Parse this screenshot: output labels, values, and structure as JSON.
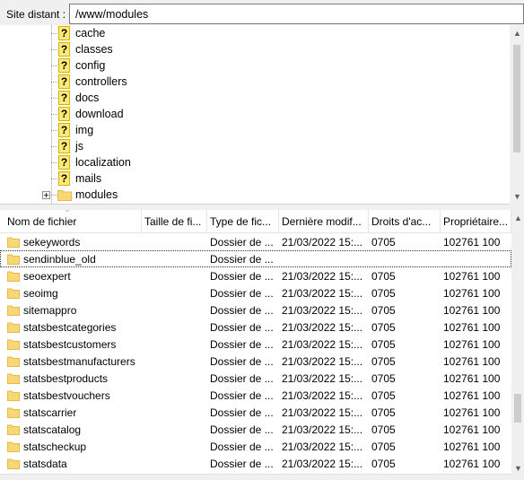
{
  "remote_site": {
    "label": "Site distant :",
    "path": "/www/modules"
  },
  "tree": {
    "items": [
      {
        "name": "cache",
        "icon": "question-folder-icon"
      },
      {
        "name": "classes",
        "icon": "question-folder-icon"
      },
      {
        "name": "config",
        "icon": "question-folder-icon"
      },
      {
        "name": "controllers",
        "icon": "question-folder-icon"
      },
      {
        "name": "docs",
        "icon": "question-folder-icon"
      },
      {
        "name": "download",
        "icon": "question-folder-icon"
      },
      {
        "name": "img",
        "icon": "question-folder-icon"
      },
      {
        "name": "js",
        "icon": "question-folder-icon"
      },
      {
        "name": "localization",
        "icon": "question-folder-icon"
      },
      {
        "name": "mails",
        "icon": "question-folder-icon"
      },
      {
        "name": "modules",
        "icon": "folder-icon",
        "expandable": true
      }
    ],
    "question_glyph": "?"
  },
  "file_list": {
    "columns": [
      "Nom de fichier",
      "Taille de fi...",
      "Type de fic...",
      "Dernière modif...",
      "Droits d'ac...",
      "Propriétaire..."
    ],
    "sort_indicator": "^",
    "rows": [
      {
        "name": "sekeywords",
        "size": "",
        "type": "Dossier de ...",
        "modified": "21/03/2022 15:...",
        "perms": "0705",
        "owner": "102761 100"
      },
      {
        "name": "sendinblue_old",
        "size": "",
        "type": "Dossier de ...",
        "modified": "",
        "perms": "",
        "owner": "",
        "selected": true
      },
      {
        "name": "seoexpert",
        "size": "",
        "type": "Dossier de ...",
        "modified": "21/03/2022 15:...",
        "perms": "0705",
        "owner": "102761 100"
      },
      {
        "name": "seoimg",
        "size": "",
        "type": "Dossier de ...",
        "modified": "21/03/2022 15:...",
        "perms": "0705",
        "owner": "102761 100"
      },
      {
        "name": "sitemappro",
        "size": "",
        "type": "Dossier de ...",
        "modified": "21/03/2022 15:...",
        "perms": "0705",
        "owner": "102761 100"
      },
      {
        "name": "statsbestcategories",
        "size": "",
        "type": "Dossier de ...",
        "modified": "21/03/2022 15:...",
        "perms": "0705",
        "owner": "102761 100"
      },
      {
        "name": "statsbestcustomers",
        "size": "",
        "type": "Dossier de ...",
        "modified": "21/03/2022 15:...",
        "perms": "0705",
        "owner": "102761 100"
      },
      {
        "name": "statsbestmanufacturers",
        "size": "",
        "type": "Dossier de ...",
        "modified": "21/03/2022 15:...",
        "perms": "0705",
        "owner": "102761 100"
      },
      {
        "name": "statsbestproducts",
        "size": "",
        "type": "Dossier de ...",
        "modified": "21/03/2022 15:...",
        "perms": "0705",
        "owner": "102761 100"
      },
      {
        "name": "statsbestvouchers",
        "size": "",
        "type": "Dossier de ...",
        "modified": "21/03/2022 15:...",
        "perms": "0705",
        "owner": "102761 100"
      },
      {
        "name": "statscarrier",
        "size": "",
        "type": "Dossier de ...",
        "modified": "21/03/2022 15:...",
        "perms": "0705",
        "owner": "102761 100"
      },
      {
        "name": "statscatalog",
        "size": "",
        "type": "Dossier de ...",
        "modified": "21/03/2022 15:...",
        "perms": "0705",
        "owner": "102761 100"
      },
      {
        "name": "statscheckup",
        "size": "",
        "type": "Dossier de ...",
        "modified": "21/03/2022 15:...",
        "perms": "0705",
        "owner": "102761 100"
      },
      {
        "name": "statsdata",
        "size": "",
        "type": "Dossier de ...",
        "modified": "21/03/2022 15:...",
        "perms": "0705",
        "owner": "102761 100"
      }
    ]
  },
  "scrollbar": {
    "up_glyph": "▲",
    "down_glyph": "▼"
  },
  "colors": {
    "folder_fill": "#f8d775",
    "folder_tab": "#e8b84a",
    "question_bg": "#ffe97a"
  }
}
